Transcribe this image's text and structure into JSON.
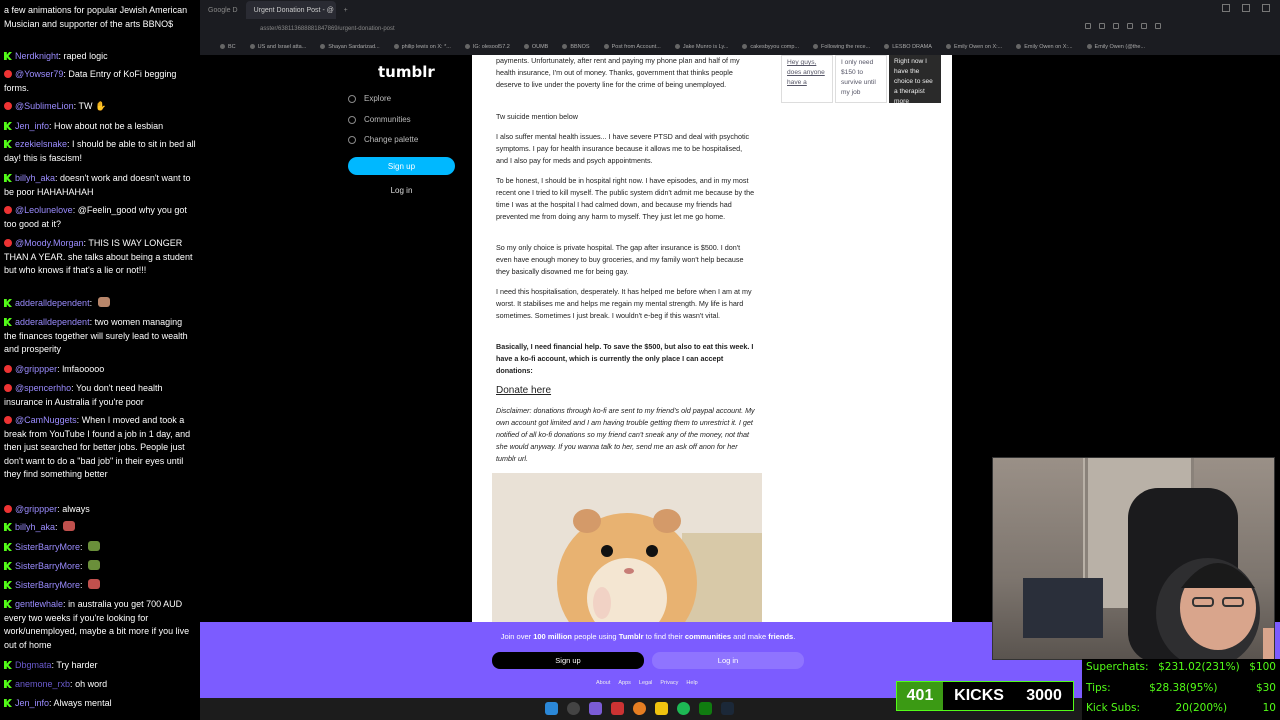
{
  "browser": {
    "tabs": [
      "Google D",
      "Urgent Donation Post - @"
    ],
    "url": "asster/638113688881847869/urgent-donation-post",
    "bookmarks": [
      "BC",
      "US and Israel atta...",
      "Shayan Sardarizad...",
      "philip lewis on X: *...",
      "IG: olesool57.2",
      "OUMB",
      "BBNOS",
      "Post from Account...",
      "Jake Munro is Ly...",
      "cakesbyyou comp...",
      "Following the rece...",
      "LESBO DRAMA",
      "Emily Owen on X:...",
      "Emily Owen on X:...",
      "Emily Owen (@the..."
    ]
  },
  "tumblr": {
    "logo": "tumblr",
    "nav": [
      "Explore",
      "Communities",
      "Change palette"
    ],
    "signup": "Sign up",
    "login": "Log in"
  },
  "post": {
    "p1": "payments. Unfortunately, after rent and paying my phone plan and half of my health insurance, I'm out of money. Thanks, government that thinks people deserve to live under the poverty line for the crime of being unemployed.",
    "p2": "Tw suicide mention below",
    "p3": "I also suffer mental health issues... I have severe PTSD and deal with psychotic symptoms. I pay for health insurance because it allows me to be hospitalised, and I also pay for meds and psych appointments.",
    "p4": "To be honest, I should be in hospital right now. I have episodes, and in my most recent one I tried to kill myself. The public system didn't admit me because by the time I was at the hospital I had calmed down, and because my friends had prevented me from doing any harm to myself. They just let me go home.",
    "p5": "So my only choice is private hospital. The gap after insurance is $500. I don't even have enough money to buy groceries, and my family won't help because they basically disowned me for being gay.",
    "p6": "I need this hospitalisation, desperately. It has helped me before when I am at my worst. It stabilises me and helps me regain my mental strength. My life is hard sometimes. Sometimes I just break. I wouldn't e-beg if this wasn't vital.",
    "p7": "Basically, I need financial help. To save the $500, but also to eat this week. I have a ko-fi account, which is currently the only place I can accept donations:",
    "donate": "Donate here",
    "disclaimer": "Disclaimer: donations through ko-fi are sent to my friend's old paypal account. My own account got limited and I am having trouble getting them to unrestrict it. I get notified of all ko-fi donations so my friend can't sneak any of the money, not that she would anyway. If you wanna talk to her, send me an ask off anon for her tumblr url."
  },
  "side_cards": [
    {
      "text": "Hey guys, does anyone have a"
    },
    {
      "text": "I only need $150 to survive until my job"
    },
    {
      "text": "Right now I have the choice to see a therapist more"
    }
  ],
  "chat": [
    {
      "src": "none",
      "user": "",
      "text": "a few animations for popular Jewish American Musician and supporter of the arts BBNO$",
      "color": "#fff"
    },
    {
      "src": "k",
      "user": "Nerdknight",
      "text": "raped logic",
      "color": "#9b8cff"
    },
    {
      "src": "yt",
      "user": "@Yowser79",
      "text": "Data Entry of KoFi begging forms.",
      "color": "#9b8cff"
    },
    {
      "src": "yt",
      "user": "@SublimeLion",
      "text": "TW ✋",
      "color": "#9b8cff"
    },
    {
      "src": "k",
      "user": "Jen_info",
      "text": "How about not be a lesbian",
      "color": "#9b8cff"
    },
    {
      "src": "k",
      "user": "ezekielsnake",
      "text": "I should be able to sit in bed all day! this is fascism!",
      "color": "#9b8cff"
    },
    {
      "src": "k",
      "user": "billyh_aka",
      "text": "doesn't work and doesn't want to be poor HAHAHAHAH",
      "color": "#9b8cff"
    },
    {
      "src": "yt",
      "user": "@Leolunelove",
      "text": "@Feelin_good why you got too good at it?",
      "color": "#9b8cff"
    },
    {
      "src": "yt",
      "user": "@Moody.Morgan",
      "text": "THIS IS WAY LONGER THAN A YEAR. she talks about being a student but who knows if that's a lie or not!!!",
      "color": "#9b8cff"
    },
    {
      "src": "k",
      "user": "adderalldependent",
      "text": "",
      "color": "#9b8cff",
      "emote": "#b8866a"
    },
    {
      "src": "k",
      "user": "adderalldependent",
      "text": "two women managing the finances together will surely lead to wealth and prosperity",
      "color": "#9b8cff"
    },
    {
      "src": "yt",
      "user": "@grippper",
      "text": "lmfaooooo",
      "color": "#9b8cff"
    },
    {
      "src": "yt",
      "user": "@spencerhho",
      "text": "You don't need health insurance in Australia if you're poor",
      "color": "#9b8cff"
    },
    {
      "src": "yt",
      "user": "@CamNuggets",
      "text": "When I moved and took a break from YouTube I found a job in 1 day, and then just searched for better jobs. People just don't want to do a \"bad job\" in their eyes until they find something better",
      "color": "#9b8cff"
    },
    {
      "src": "yt",
      "user": "@grippper",
      "text": "always",
      "color": "#9b8cff"
    },
    {
      "src": "k",
      "user": "billyh_aka",
      "text": "",
      "color": "#9b8cff",
      "emote": "#c0504d"
    },
    {
      "src": "k",
      "user": "SisterBarryMore",
      "text": "",
      "color": "#9b8cff",
      "emote": "#6a8f3a"
    },
    {
      "src": "k",
      "user": "SisterBarryMore",
      "text": "",
      "color": "#9b8cff",
      "emote": "#6a8f3a"
    },
    {
      "src": "k",
      "user": "SisterBarryMore",
      "text": "",
      "color": "#9b8cff",
      "emote": "#c0504d"
    },
    {
      "src": "k",
      "user": "gentlewhale",
      "text": "in australia you get 700 AUD every two weeks if you're looking for work/unemployed, maybe a bit more if you live out of home",
      "color": "#9b8cff"
    },
    {
      "src": "k",
      "user": "Dbgmata",
      "text": "Try harder",
      "color": "#6a5acd"
    },
    {
      "src": "k",
      "user": "anemone_rxb",
      "text": "oh word",
      "color": "#6a5acd"
    },
    {
      "src": "k",
      "user": "Jen_info",
      "text": "Always mental",
      "color": "#9b8cff"
    }
  ],
  "banner": {
    "text_parts": [
      "Join over ",
      "100 million",
      " people using ",
      "Tumblr",
      " to find their ",
      "communities",
      " and make ",
      "friends",
      "."
    ],
    "signup": "Sign up",
    "login": "Log in",
    "footer": [
      "About",
      "Apps",
      "Legal",
      "Privacy",
      "Help"
    ]
  },
  "stats": {
    "kicks_count": "401",
    "kicks_label": "KICKS",
    "kicks_goal": "3000",
    "superchats_label": "Superchats:",
    "superchats_value": "$231.02(231%)",
    "superchats_goal": "$100",
    "tips_label": "Tips:",
    "tips_value": "$28.38(95%)",
    "tips_goal": "$30",
    "subs_label": "Kick Subs:",
    "subs_value": "20(200%)",
    "subs_goal": "10"
  },
  "colors": {
    "kick_green": "#53fc18",
    "youtube_red": "#e33333",
    "tumblr_banner": "#7c5cff",
    "signup_blue": "#00b8ff"
  }
}
